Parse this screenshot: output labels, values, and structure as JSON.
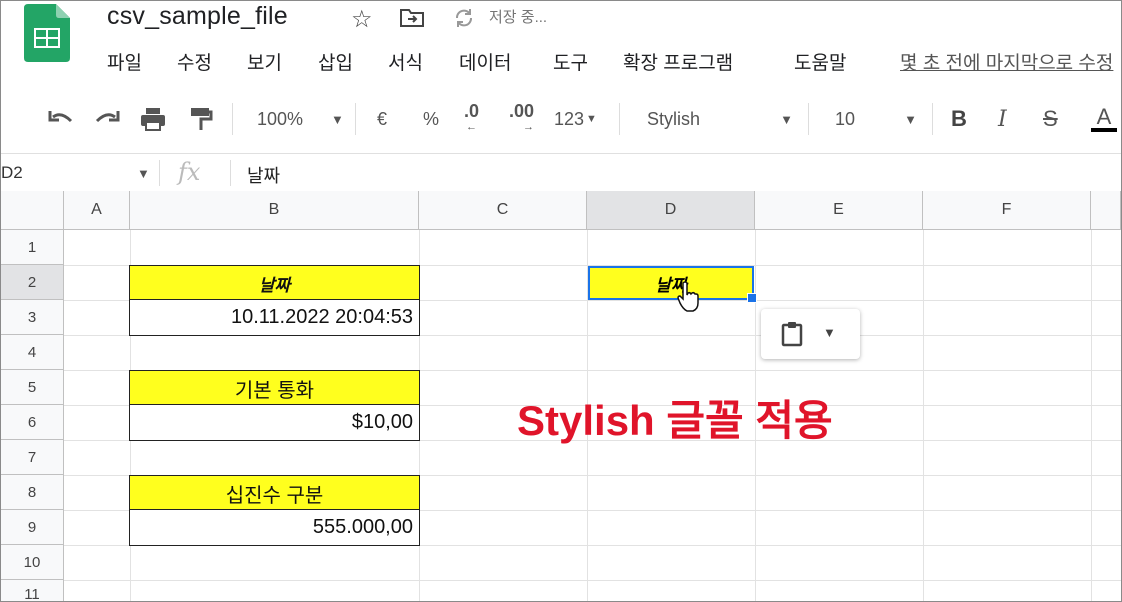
{
  "app": {
    "doc_title": "csv_sample_file",
    "save_status": "저장 중...",
    "menu": [
      "파일",
      "수정",
      "보기",
      "삽입",
      "서식",
      "데이터",
      "도구",
      "확장 프로그램",
      "도움말"
    ],
    "last_edit": "몇 초 전에 마지막으로 수정"
  },
  "toolbar": {
    "zoom": "100%",
    "currency": "€",
    "percent": "%",
    "dec_decrease": ".0",
    "dec_increase": ".00",
    "format_more": "123",
    "font": "Stylish",
    "font_size": "10",
    "bold": "B",
    "italic": "I",
    "strike": "S",
    "text_color": "A"
  },
  "formula_bar": {
    "cell_ref": "D2",
    "fx": "fx",
    "value": "날짜"
  },
  "grid": {
    "columns": [
      "A",
      "B",
      "C",
      "D",
      "E",
      "F"
    ],
    "rows": [
      "1",
      "2",
      "3",
      "4",
      "5",
      "6",
      "7",
      "8",
      "9",
      "10",
      "11"
    ],
    "selected_column": "D",
    "cells": {
      "B2": "날짜",
      "B3": "10.11.2022 20:04:53",
      "B5": "기본 통화",
      "B6": "$10,00",
      "B8": "십진수 구분",
      "B9": "555.000,00",
      "D2": "날짜"
    }
  },
  "annotation": "Stylish 글꼴 적용",
  "colors": {
    "highlight": "#ffff1e",
    "selection": "#1a73e8",
    "annotation": "#e0142a"
  }
}
